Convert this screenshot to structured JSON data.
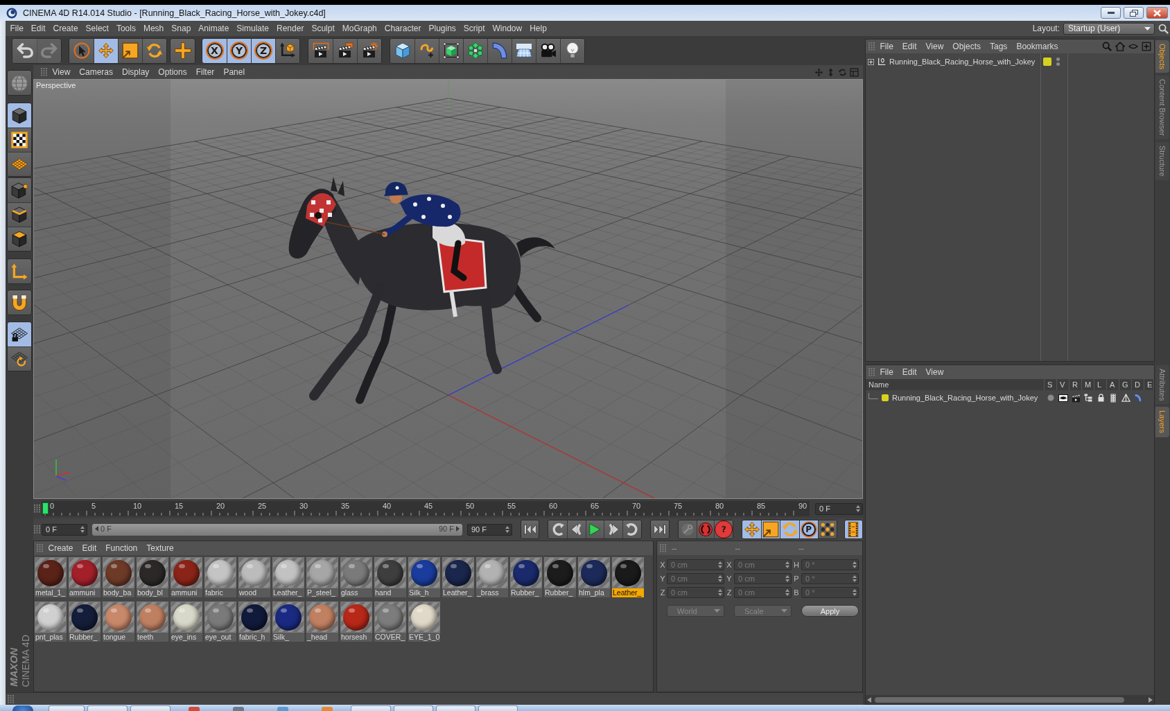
{
  "window": {
    "title": "CINEMA 4D R14.014 Studio - [Running_Black_Racing_Horse_with_Jokey.c4d]"
  },
  "menu_bar": {
    "items": [
      "File",
      "Edit",
      "Create",
      "Select",
      "Tools",
      "Mesh",
      "Snap",
      "Animate",
      "Simulate",
      "Render",
      "Sculpt",
      "MoGraph",
      "Character",
      "Plugins",
      "Script",
      "Window",
      "Help"
    ],
    "layout_label": "Layout:",
    "layout_value": "Startup (User)"
  },
  "main_toolbar": [
    [
      {
        "selected": false,
        "disabled": false
      },
      {
        "selected": false,
        "disabled": true
      }
    ],
    [
      {
        "selected": false,
        "disabled": false
      },
      {
        "selected": true,
        "disabled": false
      },
      {
        "selected": false,
        "disabled": false
      },
      {
        "selected": false,
        "disabled": false
      }
    ],
    [
      {
        "selected": false,
        "disabled": false
      }
    ],
    [
      {
        "label": "X",
        "selected": true,
        "disabled": false
      },
      {
        "label": "Y",
        "selected": true,
        "disabled": false
      },
      {
        "label": "Z",
        "selected": true,
        "disabled": false
      },
      {
        "selected": false,
        "disabled": false
      }
    ],
    [
      {
        "selected": false,
        "disabled": false
      },
      {
        "selected": false,
        "disabled": false
      },
      {
        "selected": false,
        "disabled": false
      }
    ],
    [
      {
        "selected": false,
        "disabled": false
      },
      {
        "selected": false,
        "disabled": false
      },
      {
        "selected": false,
        "disabled": false
      },
      {
        "selected": false,
        "disabled": false
      },
      {
        "selected": false,
        "disabled": false
      },
      {
        "selected": false,
        "disabled": false
      },
      {
        "selected": false,
        "disabled": false
      },
      {
        "selected": false,
        "disabled": false
      }
    ]
  ],
  "mode_toolbar": [
    [
      {
        "selected": false
      }
    ],
    [
      {
        "selected": true
      },
      {
        "selected": false
      },
      {
        "selected": false
      }
    ],
    [
      {
        "selected": false
      },
      {
        "selected": false
      },
      {
        "selected": false
      }
    ],
    [
      {
        "selected": false
      }
    ],
    [
      {
        "selected": false
      }
    ],
    [
      {
        "selected": true
      },
      {
        "selected": false
      }
    ]
  ],
  "logo": {
    "brand": "MAXON",
    "product": "CINEMA 4D"
  },
  "viewport": {
    "menu": [
      "View",
      "Cameras",
      "Display",
      "Options",
      "Filter",
      "Panel"
    ],
    "camera": "Perspective"
  },
  "timeline": {
    "labels": [
      "0",
      "5",
      "10",
      "15",
      "20",
      "25",
      "30",
      "35",
      "40",
      "45",
      "50",
      "55",
      "60",
      "65",
      "70",
      "75",
      "80",
      "85",
      "90"
    ],
    "playhead": {
      "level": 0
    },
    "current_frame": "0 F"
  },
  "playback": {
    "start_frame": "0 F",
    "range": {
      "start": "0 F",
      "end": "90 F",
      "level": 1
    },
    "end_frame": "90 F",
    "record_buttons": [
      {
        "disabled": true
      },
      {
        "disabled": false
      },
      {
        "label": "?",
        "disabled": false
      }
    ],
    "key_buttons": [
      {
        "selected": true
      },
      {
        "selected": true
      },
      {
        "selected": true
      },
      {
        "label": "P",
        "selected": true
      },
      {
        "selected": false
      }
    ],
    "timeline_button": {
      "selected": true
    }
  },
  "material_manager": {
    "menu": [
      "Create",
      "Edit",
      "Function",
      "Texture"
    ],
    "materials": [
      {
        "name": "metal_1_",
        "color": "#5a2218",
        "selected": false
      },
      {
        "name": "ammuni",
        "color": "#a3202a",
        "selected": false
      },
      {
        "name": "body_ba",
        "color": "#6e3a28",
        "selected": false
      },
      {
        "name": "body_bl",
        "color": "#2c2828",
        "selected": false
      },
      {
        "name": "ammuni",
        "color": "#8a2418",
        "selected": false
      },
      {
        "name": "fabric",
        "color": "#c4c4c4",
        "selected": false
      },
      {
        "name": "wood",
        "color": "#bcbcbc",
        "selected": false
      },
      {
        "name": "Leather_",
        "color": "#c2c2c2",
        "selected": false
      },
      {
        "name": "P_steel_",
        "color": "#a6a6a6",
        "selected": false
      },
      {
        "name": "glass",
        "color": "#7a7a7a",
        "selected": false
      },
      {
        "name": "hand",
        "color": "#3e3e3e",
        "selected": false
      },
      {
        "name": "Silk_h",
        "color": "#1a3c9c",
        "selected": false
      },
      {
        "name": "Leather_",
        "color": "#1a264c",
        "selected": false
      },
      {
        "name": "_brass",
        "color": "#b2b2b2",
        "selected": false
      },
      {
        "name": "Rubber_",
        "color": "#1a2a6c",
        "selected": false
      },
      {
        "name": "Rubber_",
        "color": "#1c1c1c",
        "selected": false
      },
      {
        "name": "hlm_pla",
        "color": "#1c2a5a",
        "selected": false
      },
      {
        "name": "Leather_",
        "color": "#1a1a1a",
        "selected": true
      },
      {
        "name": "pnt_plas",
        "color": "#d0d0d0",
        "selected": false
      },
      {
        "name": "Rubber_",
        "color": "#141e3a",
        "selected": false
      },
      {
        "name": "tongue",
        "color": "#c8886a",
        "selected": false
      },
      {
        "name": "teeth",
        "color": "#bf8062",
        "selected": false
      },
      {
        "name": "eye_ins",
        "color": "#d8d8c8",
        "selected": false
      },
      {
        "name": "eye_out",
        "color": "#7a7a7a",
        "selected": false
      },
      {
        "name": "fabric_h",
        "color": "#101a3a",
        "selected": false
      },
      {
        "name": "Silk_",
        "color": "#1a2a82",
        "selected": false
      },
      {
        "name": "_head",
        "color": "#c08062",
        "selected": false
      },
      {
        "name": "horsesh",
        "color": "#b82818",
        "selected": false
      },
      {
        "name": "COVER_",
        "color": "#7c7c7c",
        "selected": false
      },
      {
        "name": "EYE_1_0",
        "color": "#e0d8c8",
        "selected": false
      }
    ]
  },
  "coordinates": {
    "headers": [
      "--",
      "--",
      "--"
    ],
    "disabled": true,
    "rows": [
      {
        "position_axis": "X",
        "position": "0 cm",
        "size_axis": "X",
        "size": "0 cm",
        "rotation_axis": "H",
        "rotation": "0 °"
      },
      {
        "position_axis": "Y",
        "position": "0 cm",
        "size_axis": "Y",
        "size": "0 cm",
        "rotation_axis": "P",
        "rotation": "0 °"
      },
      {
        "position_axis": "Z",
        "position": "0 cm",
        "size_axis": "Z",
        "size": "0 cm",
        "rotation_axis": "B",
        "rotation": "0 °"
      }
    ],
    "coordinate_system": "World",
    "size_mode": "Scale",
    "apply": "Apply"
  },
  "object_manager": {
    "menu": [
      "File",
      "Edit",
      "View",
      "Objects",
      "Tags",
      "Bookmarks"
    ],
    "objects": [
      {
        "name": "Running_Black_Racing_Horse_with_Jokey",
        "expanded": false,
        "color": "#d8d21e"
      }
    ]
  },
  "layer_manager": {
    "menu": [
      "File",
      "Edit",
      "View"
    ],
    "columns": [
      "Name",
      "S",
      "V",
      "R",
      "M",
      "L",
      "A",
      "G",
      "D",
      "E"
    ],
    "layers": [
      {
        "name": "Running_Black_Racing_Horse_with_Jokey",
        "color": "#d8d21e",
        "solo": false
      }
    ]
  },
  "side_tabs": {
    "top": [
      {
        "label": "Objects",
        "selected": true
      },
      {
        "label": "Content Browser",
        "selected": false
      },
      {
        "label": "Structure",
        "selected": false
      }
    ],
    "bottom": [
      {
        "label": "Attributes",
        "selected": false
      },
      {
        "label": "Layers",
        "selected": true
      }
    ]
  }
}
